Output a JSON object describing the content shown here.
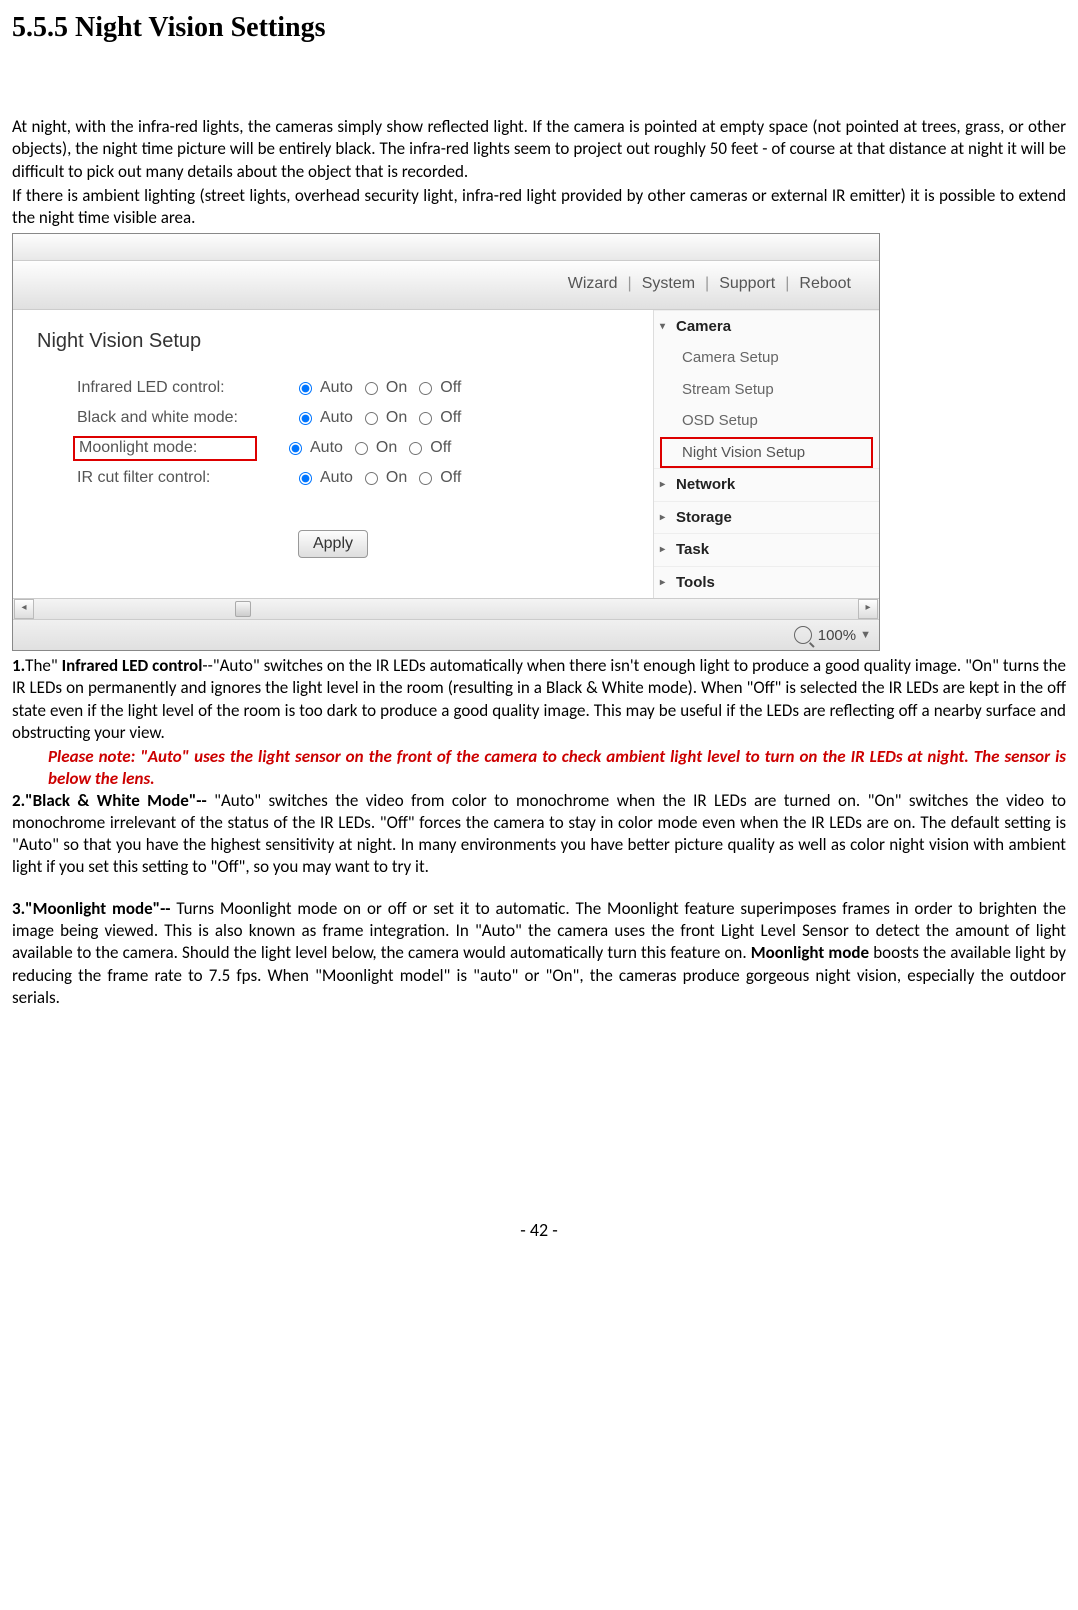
{
  "heading": "5.5.5 Night Vision Settings",
  "intro_p1": "At night, with the infra-red lights, the cameras simply show reflected light. If the camera is pointed at empty space (not pointed at trees, grass, or other objects), the night time picture will be entirely black. The infra-red lights seem to project out roughly 50 feet - of course at that distance at night it will be difficult to pick out many details about the object that is recorded.",
  "intro_p2": "If there is ambient lighting (street lights, overhead security light, infra-red light provided by other cameras or external IR emitter) it is possible to extend the night time visible area.",
  "toolbar": {
    "wizard": "Wizard",
    "system": "System",
    "support": "Support",
    "reboot": "Reboot"
  },
  "panel_title": "Night Vision Setup",
  "rows": {
    "r1": {
      "label": "Infrared LED control:",
      "o1": "Auto",
      "o2": "On",
      "o3": "Off"
    },
    "r2": {
      "label": "Black and white mode:",
      "o1": "Auto",
      "o2": "On",
      "o3": "Off"
    },
    "r3": {
      "label": "Moonlight mode:",
      "o1": "Auto",
      "o2": "On",
      "o3": "Off"
    },
    "r4": {
      "label": "IR cut filter control:",
      "o1": "Auto",
      "o2": "On",
      "o3": "Off"
    }
  },
  "apply": "Apply",
  "sidebar": {
    "camera": "Camera",
    "camera_setup": "Camera Setup",
    "stream_setup": "Stream Setup",
    "osd_setup": "OSD Setup",
    "night_vision": "Night Vision Setup",
    "network": "Network",
    "storage": "Storage",
    "task": "Task",
    "tools": "Tools"
  },
  "zoom": "100%",
  "item1_lead": "1.",
  "item1_bold": "Infrared LED control",
  "item1_rest": "--\"Auto\" switches on the IR LEDs automatically when there isn't enough light to produce a good quality image. \"On\" turns the IR LEDs on permanently and ignores the light level in the room (resulting in a Black & White mode). When \"Off\" is selected the IR LEDs are kept in the off state even if the light level of the room is too dark to produce a good quality image. This may be useful if the LEDs are reflecting off a nearby surface and obstructing your view.",
  "note_red": "Please note: \"Auto\" uses the light sensor on the front of the camera to check ambient light level to turn on the IR LEDs at night. The sensor is below the lens.",
  "item2_bold": "2.\"Black & White Mode\"--",
  "item2_rest": " \"Auto\" switches the video from color to monochrome when the IR LEDs are turned on. \"On\" switches the video to monochrome irrelevant of the status of the IR LEDs. \"Off\" forces the camera to stay in color mode even when the IR LEDs are on. The default setting is \"Auto\" so that you have the highest sensitivity at night. In many environments you have better picture quality as well as color night vision with ambient light if you set this setting to \"Off\", so you may want to try it.",
  "item3_bold": "3.\"Moonlight mode\"--",
  "item3_rest_a": " Turns Moonlight mode on or off or set it to automatic. The Moonlight feature superimposes frames in order to brighten the image being viewed. This is also known as frame integration. In \"Auto\" the camera uses the front Light Level Sensor to detect the amount of light available to the camera. Should the light level below, the camera would automatically turn this feature on. ",
  "item3_mid_bold": "Moonlight mode",
  "item3_rest_b": " boosts the available light by reducing the frame rate to 7.5 fps. When \"Moonlight model\" is \"auto\" or \"On\", the cameras produce gorgeous night vision, especially the outdoor serials.",
  "page_num": "- 42 -"
}
